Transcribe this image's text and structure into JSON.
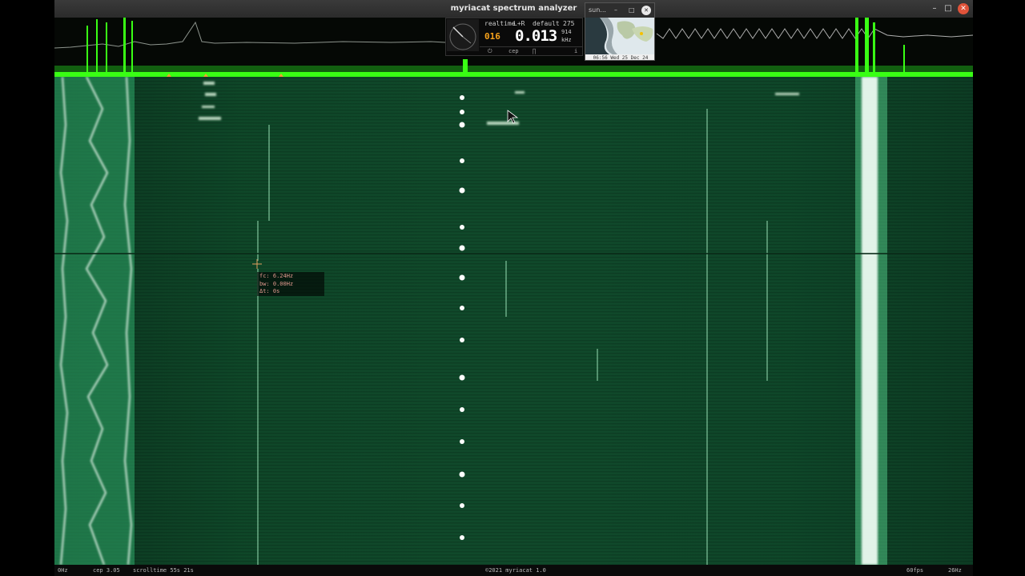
{
  "window": {
    "title": "myriacat spectrum analyzer",
    "controls": {
      "minimize": "–",
      "maximize": "□",
      "close": "✕"
    }
  },
  "realtime_panel": {
    "mode": "realtime",
    "channel": "L+R",
    "preset": "default",
    "frame_count": "275",
    "gain_digits": "016",
    "frequency": "0.013",
    "unit_top": "914",
    "unit_bottom": "kHz",
    "buttons": [
      "⏻",
      "cep",
      "∏",
      "i"
    ]
  },
  "sun_panel": {
    "title": "sun...",
    "controls": {
      "minimize": "–",
      "maximize": "□",
      "close": "✕"
    },
    "clock": "06:56 Wed 25 Dec 24"
  },
  "tooltip": {
    "fc": "fc: 6.24Hz",
    "bw": "bw: 0.00Hz",
    "dt": "Δt: 0s"
  },
  "statusbar": {
    "left_freq": "0Hz",
    "cep": "cep 3.05",
    "scrolltime": "scrolltime 55s 21s",
    "copyright": "©2021 myriacat 1.0",
    "fps": "60fps",
    "right_freq": "26Hz"
  },
  "colors": {
    "spectrum_green": "#39ff14",
    "waterfall_base": "#0f4a2a",
    "titlebar": "#2b2b2b",
    "close_button": "#e0533a",
    "tooltip_text": "#e29a8f",
    "digits": "#ffffff",
    "digits_dim": "#f7a21b"
  }
}
